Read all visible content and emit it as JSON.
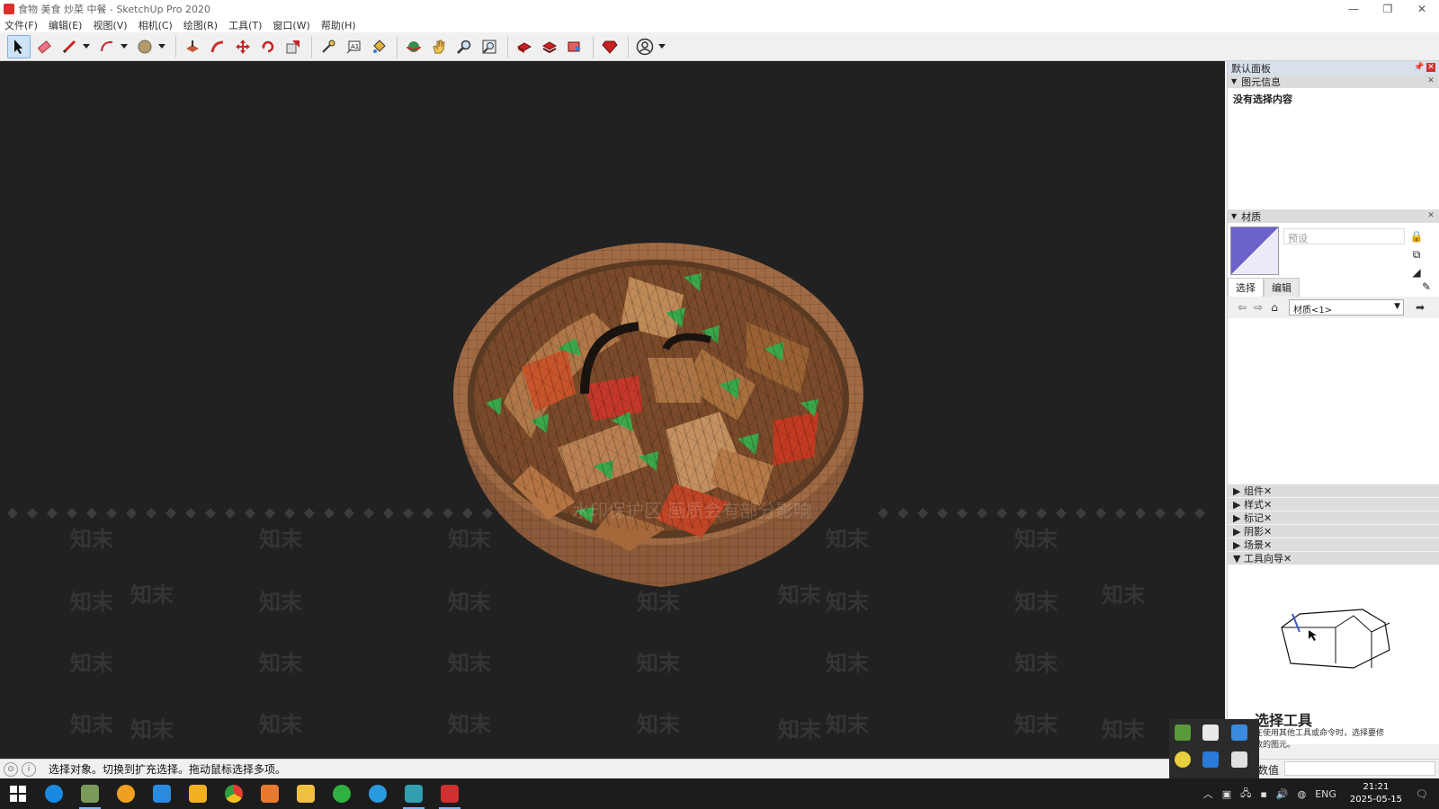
{
  "window": {
    "title": "食物 美食 炒菜 中餐 - SketchUp Pro 2020",
    "controls": [
      "—",
      "❐",
      "✕"
    ]
  },
  "menubar": {
    "items": [
      "文件(F)",
      "编辑(E)",
      "视图(V)",
      "相机(C)",
      "绘图(R)",
      "工具(T)",
      "窗口(W)",
      "帮助(H)"
    ]
  },
  "toolbar": {
    "tools": [
      {
        "name": "select-tool",
        "icon": "arrow-icon",
        "active": true
      },
      {
        "name": "eraser-tool",
        "icon": "eraser-icon"
      },
      {
        "name": "line-tool",
        "icon": "pencil-icon"
      },
      {
        "name": "arc-tool",
        "icon": "arc-icon"
      },
      {
        "name": "shape-tool",
        "icon": "circle-icon"
      },
      {
        "name": "push-pull-tool",
        "icon": "push-pull-icon"
      },
      {
        "name": "follow-me-tool",
        "icon": "follow-me-icon"
      },
      {
        "name": "move-tool",
        "icon": "move-icon"
      },
      {
        "name": "rotate-tool",
        "icon": "rotate-icon"
      },
      {
        "name": "scale-tool",
        "icon": "scale-icon"
      },
      {
        "name": "tape-measure-tool",
        "icon": "tape-icon"
      },
      {
        "name": "text-tool",
        "icon": "text-icon"
      },
      {
        "name": "paint-bucket-tool",
        "icon": "paint-bucket-icon"
      },
      {
        "name": "orbit-tool",
        "icon": "orbit-icon"
      },
      {
        "name": "pan-tool",
        "icon": "hand-icon"
      },
      {
        "name": "zoom-tool",
        "icon": "zoom-icon"
      },
      {
        "name": "zoom-extents-tool",
        "icon": "zoom-extents-icon"
      },
      {
        "name": "warehouse-tool",
        "icon": "warehouse-icon"
      },
      {
        "name": "extension-warehouse-tool",
        "icon": "extension-warehouse-icon"
      },
      {
        "name": "send-to-layout-tool",
        "icon": "layout-icon"
      },
      {
        "name": "extension-manager-tool",
        "icon": "ruby-icon"
      },
      {
        "name": "account-tool",
        "icon": "user-icon"
      }
    ]
  },
  "viewport": {
    "watermark_text": "知末",
    "notice_text": "水印保护区 画质会有部分影响"
  },
  "panel": {
    "tray_title": "默认面板",
    "entity_info": {
      "title": "图元信息",
      "status": "没有选择内容"
    },
    "materials": {
      "title": "材质",
      "name_placeholder": "预设",
      "tab_select": "选择",
      "tab_edit": "编辑",
      "library": "材质<1>"
    },
    "collapsed": [
      "组件",
      "样式",
      "标记",
      "阴影",
      "场景"
    ],
    "instructor": {
      "title": "工具向导",
      "tool_name": "选择工具",
      "desc": "在使用其他工具或命令时，选择要修改的图元。"
    }
  },
  "statusbar": {
    "hint": "选择对象。切换到扩充选择。拖动鼠标选择多项。",
    "measure_label": "数值"
  },
  "taskbar": {
    "lang": "ENG",
    "time": "21:21",
    "date": "2025-05-15"
  }
}
